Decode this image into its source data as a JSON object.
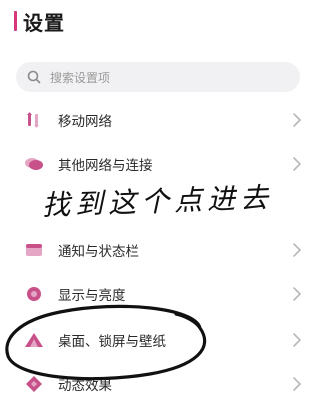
{
  "header": {
    "title": "设置",
    "accent_color": "#d7367a"
  },
  "search": {
    "placeholder": "搜索设置项",
    "icon": "search-icon"
  },
  "items": [
    {
      "label": "移动网络",
      "icon": "mobile-network-icon"
    },
    {
      "label": "其他网络与连接",
      "icon": "network-connection-icon"
    },
    {
      "label": "通知与状态栏",
      "icon": "notification-icon"
    },
    {
      "label": "显示与亮度",
      "icon": "display-brightness-icon"
    },
    {
      "label": "桌面、锁屏与壁纸",
      "icon": "desktop-wallpaper-icon"
    },
    {
      "label": "动态效果",
      "icon": "motion-effects-icon"
    }
  ],
  "annotation": {
    "handwritten_note": "找到这个点进去"
  },
  "colors": {
    "icon_pink": "#c8518a",
    "icon_pink_light": "#e4a6c4",
    "chevron": "#b8b8b8"
  }
}
